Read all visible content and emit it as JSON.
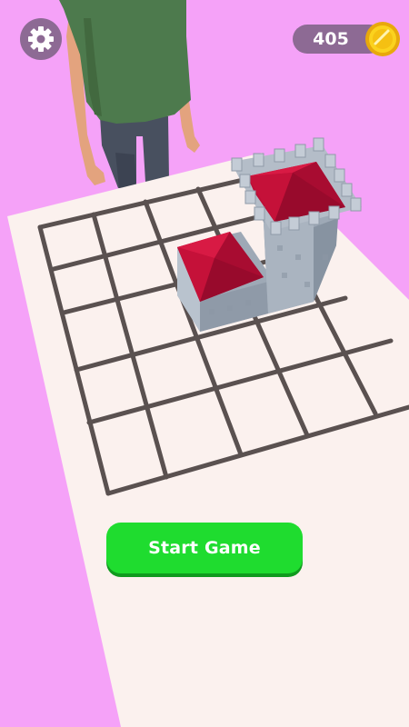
{
  "hud": {
    "settings_icon": "gear-icon",
    "coins": "405",
    "coin_icon": "gold-coin-icon"
  },
  "start_button": {
    "label": "Start Game"
  },
  "colors": {
    "background": "#f5a2f8",
    "board": "#fbf1ee",
    "grid_line": "#5a5150",
    "button": "#1fdc2f",
    "hud_pill": "#8d6a94",
    "castle_stone": "#a7b2c0",
    "castle_roof": "#c9103c"
  }
}
